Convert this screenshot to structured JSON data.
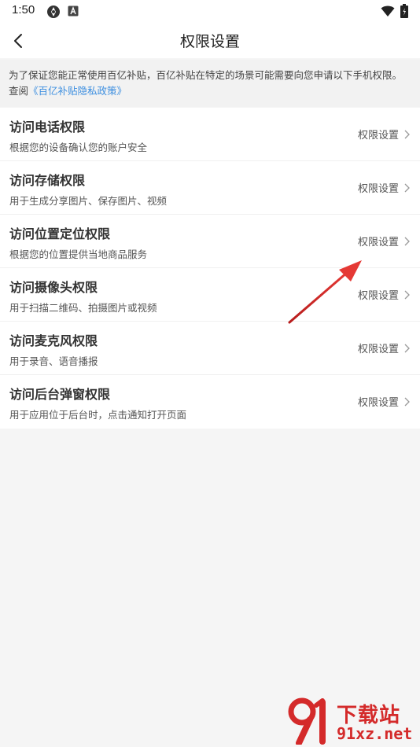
{
  "status_bar": {
    "time": "1:50",
    "icons": [
      "app-notification-icon",
      "a-letter-icon",
      "wifi-icon",
      "battery-icon"
    ]
  },
  "header": {
    "title": "权限设置"
  },
  "notice": {
    "text_before": "为了保证您能正常使用百亿补贴，百亿补贴在特定的场景可能需要向您申请以下手机权限。查阅",
    "link_text": "《百亿补贴隐私政策》"
  },
  "permissions": [
    {
      "title": "访问电话权限",
      "description": "根据您的设备确认您的账户安全",
      "action": "权限设置"
    },
    {
      "title": "访问存储权限",
      "description": "用于生成分享图片、保存图片、视频",
      "action": "权限设置"
    },
    {
      "title": "访问位置定位权限",
      "description": "根据您的位置提供当地商品服务",
      "action": "权限设置"
    },
    {
      "title": "访问摄像头权限",
      "description": "用于扫描二维码、拍摄图片或视频",
      "action": "权限设置"
    },
    {
      "title": "访问麦克风权限",
      "description": "用于录音、语音播报",
      "action": "权限设置"
    },
    {
      "title": "访问后台弹窗权限",
      "description": "用于应用位于后台时，点击通知打开页面",
      "action": "权限设置"
    }
  ],
  "watermark": {
    "text": "下载站",
    "url": "91xz.net"
  },
  "colors": {
    "link": "#3d8fe0",
    "annotation_arrow": "#d62626",
    "watermark": "#d42a2a"
  }
}
